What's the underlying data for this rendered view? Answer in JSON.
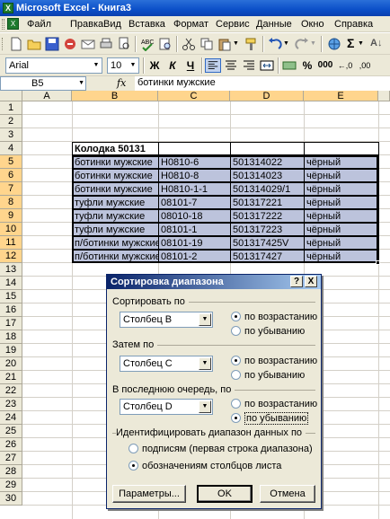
{
  "window": {
    "title": "Microsoft Excel - Книга3",
    "app_icon_glyph": "X"
  },
  "menu": [
    "Файл",
    "Правка",
    "Вид",
    "Вставка",
    "Формат",
    "Сервис",
    "Данные",
    "Окно",
    "Справка"
  ],
  "toolbar": {
    "font": "Arial",
    "font_size": "10",
    "bold": "Ж",
    "italic": "К",
    "underline": "Ч",
    "percent": "%",
    "thousands": "000"
  },
  "formula_bar": {
    "cell_ref": "B5",
    "fx": "fx",
    "content": "ботинки мужские"
  },
  "columns": [
    "A",
    "B",
    "C",
    "D",
    "E"
  ],
  "rows": [
    "1",
    "2",
    "3",
    "4",
    "5",
    "6",
    "7",
    "8",
    "9",
    "10",
    "11",
    "12",
    "13",
    "14",
    "15",
    "16",
    "17",
    "18",
    "19",
    "20",
    "21",
    "22",
    "23",
    "24",
    "25",
    "26",
    "27",
    "28",
    "29",
    "30"
  ],
  "sheet": {
    "header_cell": "Колодка 50131",
    "data": [
      [
        "ботинки мужские",
        "Н0810-6",
        "501314022",
        "чёрный"
      ],
      [
        "ботинки мужские",
        "Н0810-8",
        "501314023",
        "чёрный"
      ],
      [
        "ботинки мужские",
        "Н0810-1-1",
        "501314029/1",
        "чёрный"
      ],
      [
        "туфли мужские",
        "08101-7",
        "501317221",
        "чёрный"
      ],
      [
        "туфли мужские",
        "08010-18",
        "501317222",
        "чёрный"
      ],
      [
        "туфли мужские",
        "08101-1",
        "501317223",
        "чёрный"
      ],
      [
        "п/ботинки мужские",
        "08101-19",
        "501317425V",
        "чёрный"
      ],
      [
        "п/ботинки мужские",
        "08101-2",
        "501317427",
        "чёрный"
      ]
    ]
  },
  "dialog": {
    "title": "Сортировка диапазона",
    "help_btn": "?",
    "close_btn": "X",
    "sort_by_label": "Сортировать по",
    "sort_by_value": "Столбец B",
    "then_by_label": "Затем по",
    "then_by_value": "Столбец C",
    "last_by_label": "В последнюю очередь, по",
    "last_by_value": "Столбец D",
    "asc": "по возрастанию",
    "desc": "по убыванию",
    "identify_label": "Идентифицировать диапазон данных по",
    "by_headers": "подписям (первая строка диапазона)",
    "by_column_labels": "обозначениям столбцов листа",
    "params_btn": "Параметры...",
    "ok_btn": "OK",
    "cancel_btn": "Отмена"
  }
}
